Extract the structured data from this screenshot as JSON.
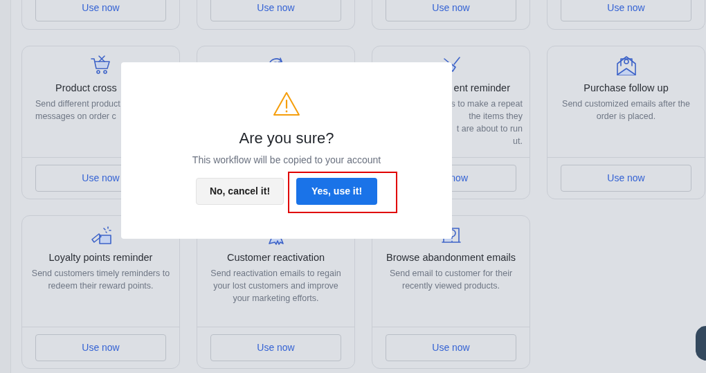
{
  "rows": [
    {
      "cards": [
        {
          "button": "Use now"
        },
        {
          "button": "Use now"
        },
        {
          "button": "Use now"
        },
        {
          "button": "Use now"
        }
      ]
    },
    {
      "cards": [
        {
          "kind": "workflow",
          "title": "Product cross",
          "description": "Send different product\nmessages on order c",
          "button": "Use now"
        },
        {
          "kind": "covered"
        },
        {
          "kind": "workflow",
          "title": "ent reminder",
          "description": "s to make a repeat\nthe items they\nt are about to run\nut.",
          "button": "now"
        },
        {
          "kind": "workflow",
          "title": "Purchase follow up",
          "description": "Send customized emails after the\norder is placed.",
          "button": "Use now"
        }
      ]
    },
    {
      "cards": [
        {
          "title": "Loyalty points reminder",
          "description": "Send customers timely reminders to\nredeem their reward points.",
          "button": "Use now"
        },
        {
          "title": "Customer reactivation",
          "description": "Send reactivation emails to regain\nyour lost customers and improve\nyour marketing efforts.",
          "button": "Use now"
        },
        {
          "title": "Browse abandonment emails",
          "description": "Send email to customer for their\nrecently viewed products.",
          "button": "Use now"
        }
      ]
    }
  ],
  "dialog": {
    "title": "Are you sure?",
    "message": "This workflow will be copied to your account",
    "buttons": [
      {
        "label": "No, cancel it!",
        "kind": "cancel",
        "highlighted": false
      },
      {
        "label": "Yes, use it!",
        "kind": "confirm",
        "highlighted": true
      }
    ]
  }
}
